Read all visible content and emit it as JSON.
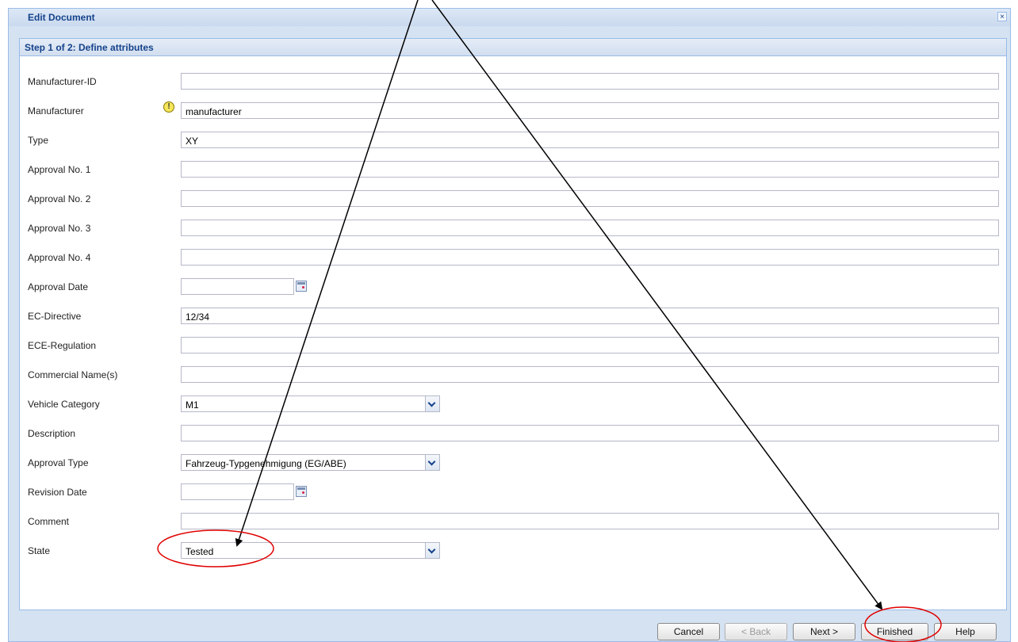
{
  "window": {
    "title": "Edit Document",
    "close_glyph": "×"
  },
  "step_header": "Step 1 of 2: Define attributes",
  "fields": {
    "manufacturer_id": {
      "label": "Manufacturer-ID",
      "value": ""
    },
    "manufacturer": {
      "label": "Manufacturer",
      "value": "manufacturer",
      "warning_icon": "!"
    },
    "type": {
      "label": "Type",
      "value": "XY"
    },
    "approval_no_1": {
      "label": "Approval No. 1",
      "value": ""
    },
    "approval_no_2": {
      "label": "Approval No. 2",
      "value": ""
    },
    "approval_no_3": {
      "label": "Approval No. 3",
      "value": ""
    },
    "approval_no_4": {
      "label": "Approval No. 4",
      "value": ""
    },
    "approval_date": {
      "label": "Approval Date",
      "value": ""
    },
    "ec_directive": {
      "label": "EC-Directive",
      "value": "12/34"
    },
    "ece_regulation": {
      "label": "ECE-Regulation",
      "value": ""
    },
    "commercial_names": {
      "label": "Commercial Name(s)",
      "value": ""
    },
    "vehicle_category": {
      "label": "Vehicle Category",
      "value": "M1"
    },
    "description": {
      "label": "Description",
      "value": ""
    },
    "approval_type": {
      "label": "Approval Type",
      "value": "Fahrzeug-Typgenehmigung (EG/ABE)"
    },
    "revision_date": {
      "label": "Revision Date",
      "value": ""
    },
    "comment": {
      "label": "Comment",
      "value": ""
    },
    "state": {
      "label": "State",
      "value": "Tested"
    }
  },
  "buttons": {
    "cancel": "Cancel",
    "back": "< Back",
    "next": "Next >",
    "finished": "Finished",
    "help": "Help"
  },
  "annotation_colors": {
    "arrow": "#000000",
    "highlight": "#e00000"
  }
}
